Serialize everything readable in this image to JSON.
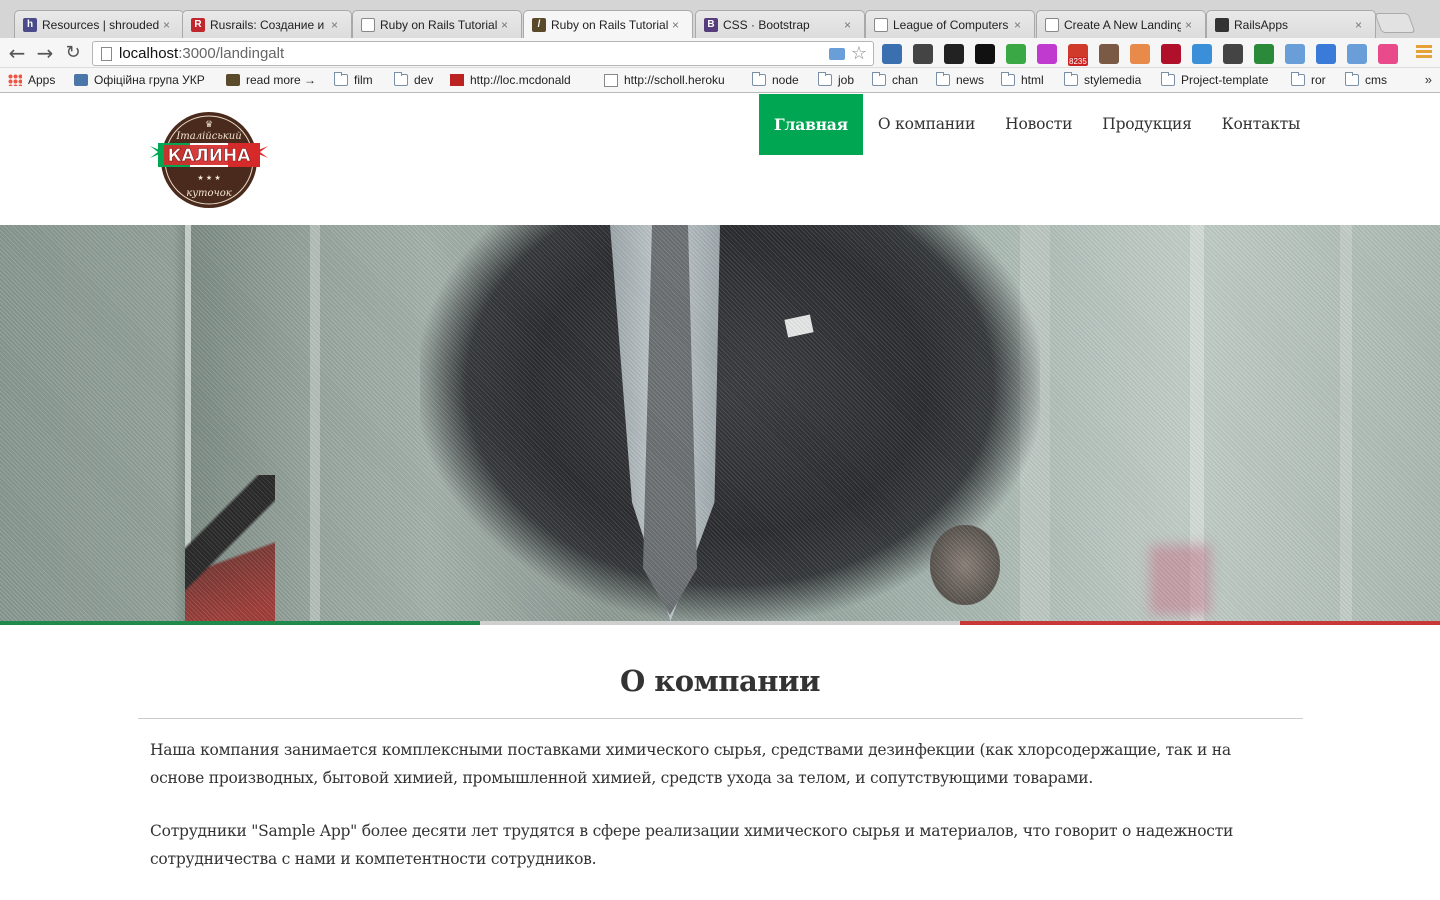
{
  "browser": {
    "tabs": [
      {
        "title": "Resources | shrouded",
        "icon": "hackpad-icon",
        "color": "#4b4b8c",
        "glyph": "h"
      },
      {
        "title": "Rusrails: Создание и",
        "icon": "rusrails-icon",
        "color": "#c0272d",
        "glyph": "R"
      },
      {
        "title": "Ruby on Rails Tutorial",
        "icon": "document-icon",
        "color": "#ffffff",
        "glyph": ""
      },
      {
        "title": "Ruby on Rails Tutorial",
        "icon": "railstutorial-icon",
        "color": "#5a4a2a",
        "glyph": "/"
      },
      {
        "title": "CSS · Bootstrap",
        "icon": "bootstrap-icon",
        "color": "#563d7c",
        "glyph": "B"
      },
      {
        "title": "League of Computers",
        "icon": "document-icon",
        "color": "#ffffff",
        "glyph": ""
      },
      {
        "title": "Create A New Landing",
        "icon": "document-icon",
        "color": "#ffffff",
        "glyph": ""
      },
      {
        "title": "RailsApps",
        "icon": "railsapps-icon",
        "color": "#333333",
        "glyph": ""
      }
    ],
    "active_tab": 3,
    "close_glyph": "×",
    "url_host": "localhost",
    "url_rest": ":3000/landingalt",
    "bookmarks": [
      {
        "label": "Apps",
        "icon": "apps-grid-icon"
      },
      {
        "label": "Офіційна група УКР",
        "icon": "vk-icon"
      },
      {
        "label": "read more →",
        "icon": "railstutorial-icon"
      },
      {
        "label": "film",
        "icon": "folder-icon"
      },
      {
        "label": "dev",
        "icon": "folder-icon"
      },
      {
        "label": "http://loc.mcdonald",
        "icon": "mcdonalds-icon"
      },
      {
        "label": "http://scholl.heroku",
        "icon": "document-icon"
      },
      {
        "label": "node",
        "icon": "folder-icon"
      },
      {
        "label": "job",
        "icon": "folder-icon"
      },
      {
        "label": "chan",
        "icon": "folder-icon"
      },
      {
        "label": "news",
        "icon": "folder-icon"
      },
      {
        "label": "html",
        "icon": "folder-icon"
      },
      {
        "label": "stylemedia",
        "icon": "folder-icon"
      },
      {
        "label": "Project-template",
        "icon": "folder-icon"
      },
      {
        "label": "ror",
        "icon": "folder-icon"
      },
      {
        "label": "cms",
        "icon": "folder-icon"
      }
    ],
    "bookmarks_overflow": "»",
    "extensions": [
      {
        "icon": "new-badge-extension-icon",
        "color": "#3a6fb0"
      },
      {
        "icon": "eyedropper-extension-icon",
        "color": "#444444"
      },
      {
        "icon": "window-resizer-extension-icon",
        "color": "#222222"
      },
      {
        "icon": "stocks-extension-icon",
        "color": "#111111"
      },
      {
        "icon": "refresh-extension-icon",
        "color": "#3aa845"
      },
      {
        "icon": "color-picker-extension-icon",
        "color": "#c13ad0"
      },
      {
        "icon": "gmail-checker-extension-icon",
        "color": "#d03a2a",
        "badge": "8235"
      },
      {
        "icon": "instagram-extension-icon",
        "color": "#7a5a44"
      },
      {
        "icon": "analytics-extension-icon",
        "color": "#e88a4a"
      },
      {
        "icon": "evernote-extension-icon",
        "color": "#b0102a"
      },
      {
        "icon": "translate-extension-icon",
        "color": "#3a8fd8"
      },
      {
        "icon": "settings-extension-icon",
        "color": "#444444"
      },
      {
        "icon": "bw-extension-icon",
        "color": "#2a8a3a"
      },
      {
        "icon": "tab-extension-icon",
        "color": "#6a9ed8"
      },
      {
        "icon": "link-extension-icon",
        "color": "#3a7ad8"
      },
      {
        "icon": "folder-extension-icon",
        "color": "#6a9ed8"
      },
      {
        "icon": "rainbow-extension-icon",
        "color": "#e84a8a"
      }
    ]
  },
  "site": {
    "logo": {
      "top": "Італійський",
      "main": "КАЛИНА",
      "bottom": "куточок"
    },
    "nav": [
      "Главная",
      "О компании",
      "Новости",
      "Продукция",
      "Контакты"
    ],
    "nav_active": 0,
    "accent": "#00a651",
    "flag_colors": [
      "#1f8a4c",
      "#cfcfcf",
      "#c93838"
    ],
    "section_title": "О компании",
    "paragraphs": [
      "Наша компания занимается комплексными поставками химического сырья, средствами дезинфекции (как хлорсодержащие, так и на основе производных, бытовой химией, промышленной химией, средств ухода за телом, и сопутствующими товарами.",
      "Сотрудники \"Sample App\" более десяти лет трудятся в сфере реализации химического сырья и материалов, что говорит о надежности сотрудничества с нами и компетентности сотрудников."
    ]
  }
}
